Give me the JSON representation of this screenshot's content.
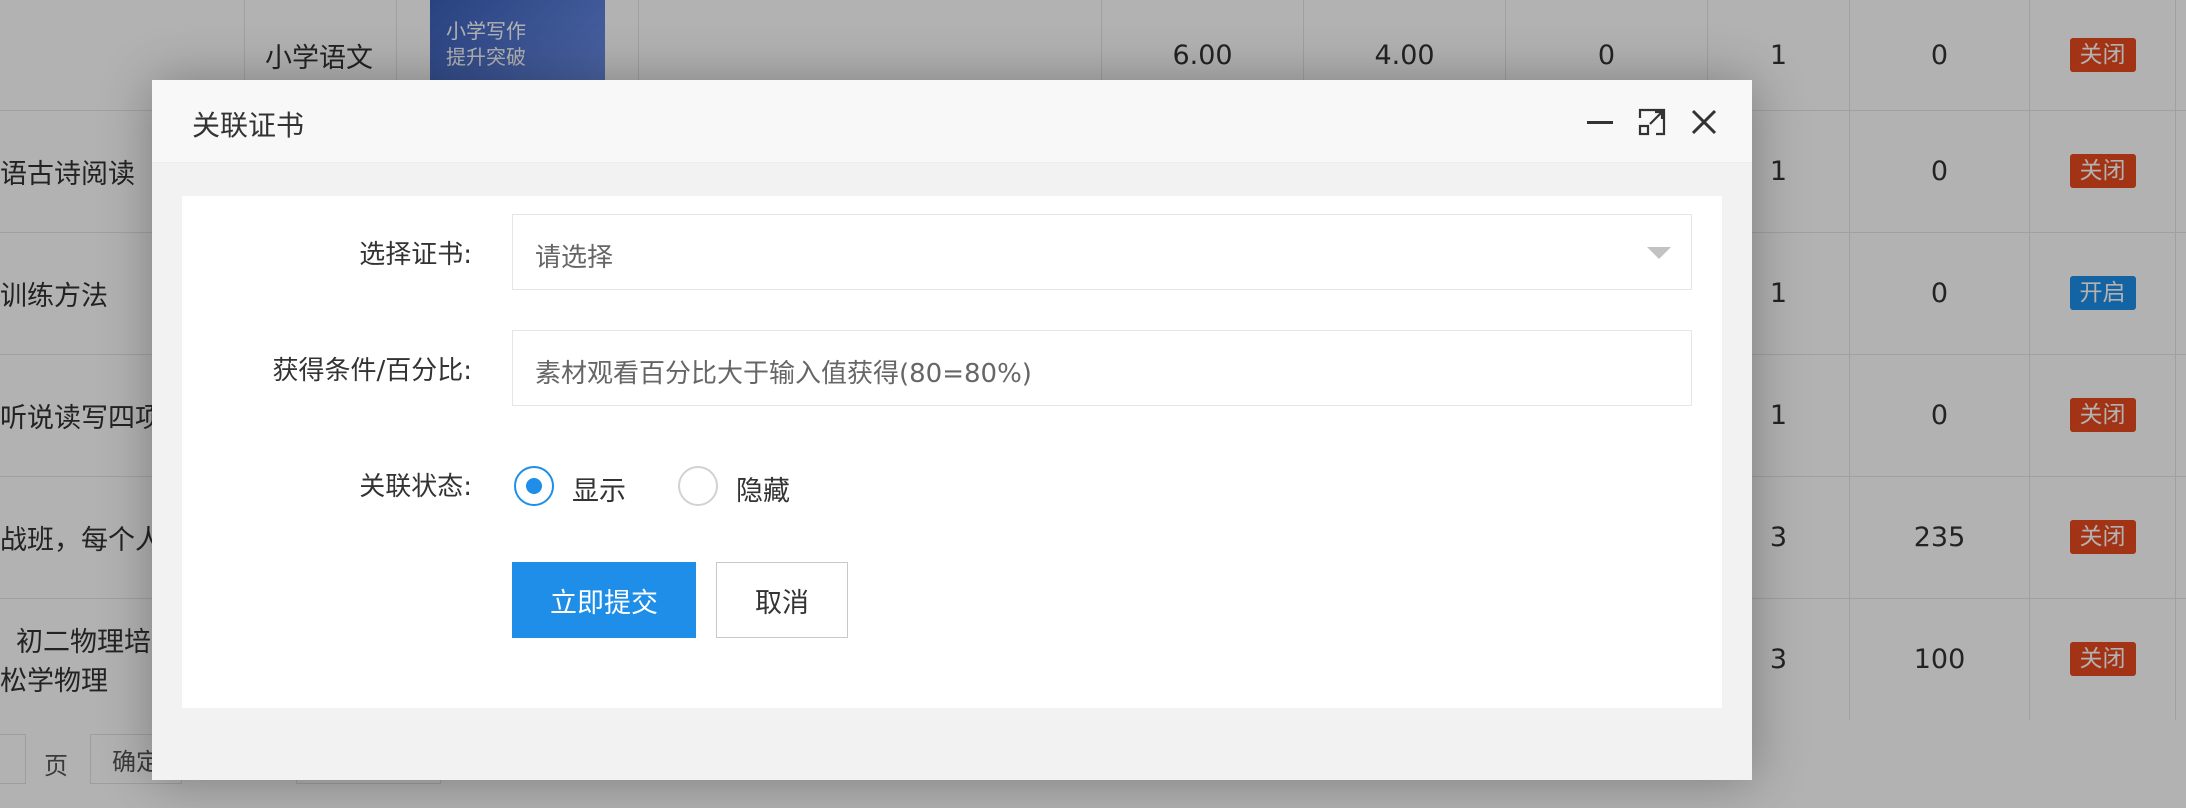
{
  "table": {
    "rows": [
      {
        "name": "小学语文",
        "thumb_line1": "小学写作",
        "thumb_line2": "提升突破",
        "price": "6.00",
        "sale_price": "4.00",
        "c1": "0",
        "c2": "1",
        "c3": "0",
        "status": "关闭",
        "status_type": "closed"
      },
      {
        "name": "语古诗阅读",
        "c2": "1",
        "c3": "0",
        "status": "关闭",
        "status_type": "closed"
      },
      {
        "name": "训练方法",
        "c2": "1",
        "c3": "0",
        "status": "开启",
        "status_type": "open"
      },
      {
        "name": "听说读写四项",
        "c2": "1",
        "c3": "0",
        "status": "关闭",
        "status_type": "closed"
      },
      {
        "name": "战班，每个人",
        "c2": "3",
        "c3": "235",
        "status": "关闭",
        "status_type": "closed"
      },
      {
        "name": "初二物理培",
        "name2": "松学物理",
        "c2": "3",
        "c3": "100",
        "status": "关闭",
        "status_type": "closed"
      }
    ]
  },
  "pager": {
    "page_label": "页",
    "confirm_label": "确定"
  },
  "modal": {
    "title": "关联证书",
    "fields": {
      "certificate_label": "选择证书:",
      "certificate_value": "请选择",
      "condition_label": "获得条件/百分比:",
      "condition_placeholder": "素材观看百分比大于输入值获得(80=80%)",
      "status_label": "关联状态:",
      "status_options": [
        {
          "label": "显示",
          "checked": true
        },
        {
          "label": "隐藏",
          "checked": false
        }
      ]
    },
    "submit_label": "立即提交",
    "cancel_label": "取消"
  },
  "colors": {
    "primary": "#1e8ee8",
    "danger": "#e8491d"
  },
  "icons": {
    "minimize": "minimize-icon",
    "maximize": "maximize-icon",
    "close": "close-icon",
    "dropdown": "chevron-down-icon"
  }
}
